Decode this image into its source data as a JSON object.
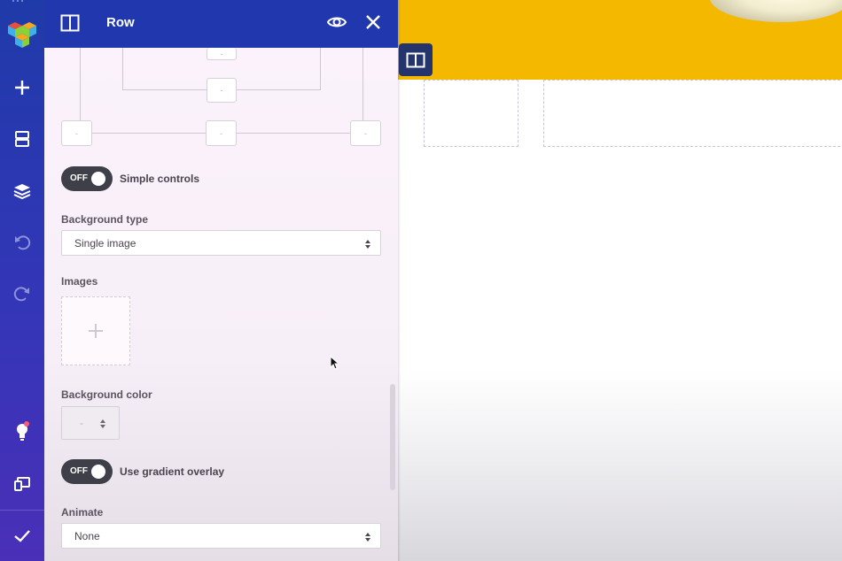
{
  "sidebar": {
    "icons": [
      "logo-cube-icon",
      "plus-icon",
      "layout-icon",
      "layers-icon",
      "undo-icon",
      "redo-icon",
      "lightbulb-icon",
      "responsive-devices-icon",
      "checkmark-icon"
    ],
    "colors": {
      "background": "#2f38b2",
      "notification": "#ff5a6e"
    }
  },
  "panel": {
    "title": "Row",
    "header_color": "#2137ad",
    "diagram": {
      "box_placeholder": "-"
    },
    "simple_controls": {
      "state": "OFF",
      "label": "Simple controls"
    },
    "background_type": {
      "label": "Background type",
      "value": "Single image"
    },
    "images": {
      "label": "Images"
    },
    "background_color": {
      "label": "Background color",
      "value": "-"
    },
    "gradient_overlay": {
      "state": "OFF",
      "label": "Use gradient overlay"
    },
    "animate": {
      "label": "Animate",
      "value": "None"
    }
  },
  "canvas": {
    "accent_color": "#f5b800"
  }
}
